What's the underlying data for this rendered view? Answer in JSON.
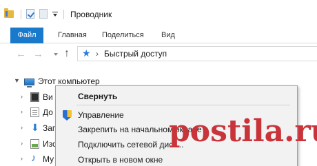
{
  "window": {
    "title": "Проводник"
  },
  "quick_access_toolbar": {
    "icons": [
      "folder-icon",
      "properties-check-icon",
      "new-folder-icon",
      "customize-dropdown-icon"
    ]
  },
  "ribbon": {
    "tabs": [
      {
        "label": "Файл",
        "active": true
      },
      {
        "label": "Главная"
      },
      {
        "label": "Поделиться"
      },
      {
        "label": "Вид"
      }
    ],
    "accent_color": "#1979ca"
  },
  "address_bar": {
    "path_icon": "quick-access-star-icon",
    "path": "Быстрый доступ"
  },
  "tree": {
    "root": {
      "label": "Этот компьютер",
      "icon": "computer-icon",
      "expanded": true
    },
    "children": [
      {
        "label": "Ви",
        "icon": "video-folder-icon"
      },
      {
        "label": "До",
        "icon": "documents-folder-icon"
      },
      {
        "label": "Заг",
        "icon": "downloads-folder-icon"
      },
      {
        "label": "Изо",
        "icon": "pictures-folder-icon"
      },
      {
        "label": "Му",
        "icon": "music-folder-icon"
      }
    ]
  },
  "context_menu": {
    "items": [
      {
        "label": "Свернуть",
        "bold": true
      },
      {
        "label": "Управление",
        "icon": "shield-icon"
      },
      {
        "label": "Закрепить на начальном экране"
      },
      {
        "label": "Подключить сетевой диск..."
      },
      {
        "label": "Открыть в новом окне"
      }
    ]
  },
  "watermark": {
    "text": "postila.ru",
    "color": "#c9343b"
  }
}
